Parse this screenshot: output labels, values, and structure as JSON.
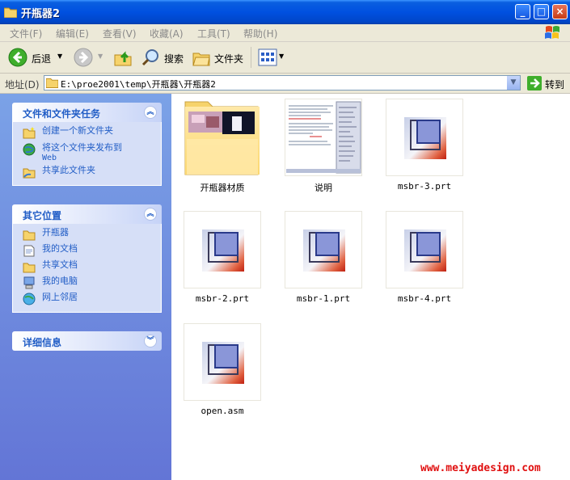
{
  "window": {
    "title": "开瓶器2",
    "minimize": "_",
    "maximize": "□",
    "close": "×"
  },
  "menu": {
    "items": [
      "文件(F)",
      "编辑(E)",
      "查看(V)",
      "收藏(A)",
      "工具(T)",
      "帮助(H)"
    ]
  },
  "toolbar": {
    "back": "后退",
    "search": "搜索",
    "folders": "文件夹"
  },
  "address": {
    "label": "地址(D)",
    "value": "E:\\proe2001\\temp\\开瓶器\\开瓶器2",
    "go": "转到"
  },
  "sidebar": {
    "tasks": {
      "title": "文件和文件夹任务",
      "items": [
        {
          "label": "创建一个新文件夹",
          "icon": "new-folder-icon"
        },
        {
          "label": "将这个文件夹发布到",
          "sub": "Web",
          "icon": "publish-web-icon"
        },
        {
          "label": "共享此文件夹",
          "icon": "share-folder-icon"
        }
      ]
    },
    "places": {
      "title": "其它位置",
      "items": [
        {
          "label": "开瓶器",
          "icon": "folder-icon"
        },
        {
          "label": "我的文档",
          "icon": "my-documents-icon"
        },
        {
          "label": "共享文档",
          "icon": "shared-documents-icon"
        },
        {
          "label": "我的电脑",
          "icon": "my-computer-icon"
        },
        {
          "label": "网上邻居",
          "icon": "network-places-icon"
        }
      ]
    },
    "details": {
      "title": "详细信息"
    }
  },
  "files": [
    {
      "name": "开瓶器材质",
      "type": "folder"
    },
    {
      "name": "说明",
      "type": "document"
    },
    {
      "name": "msbr-3.prt",
      "type": "part"
    },
    {
      "name": "msbr-2.prt",
      "type": "part"
    },
    {
      "name": "msbr-1.prt",
      "type": "part"
    },
    {
      "name": "msbr-4.prt",
      "type": "part"
    },
    {
      "name": "open.asm",
      "type": "part"
    }
  ],
  "watermark": "www.meiyadesign.com"
}
